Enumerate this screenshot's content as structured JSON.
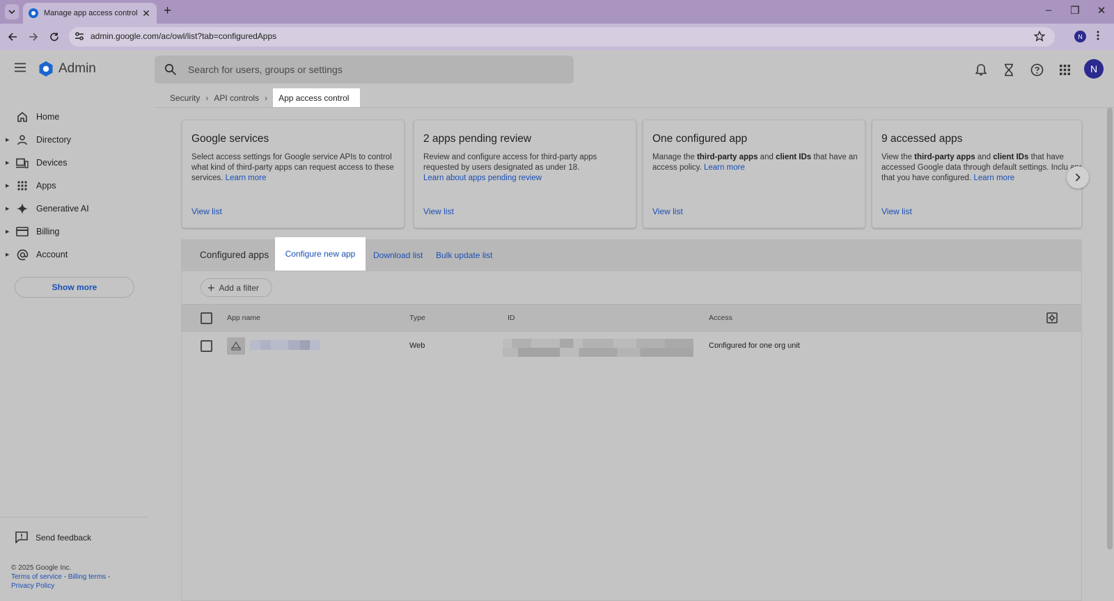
{
  "browser": {
    "tab_title": "Manage app access control – A",
    "url": "admin.google.com/ac/owl/list?tab=configuredApps",
    "profile_initial": "N"
  },
  "header": {
    "app_name": "Admin",
    "search_placeholder": "Search for users, groups or settings",
    "user_initial": "N"
  },
  "breadcrumb": {
    "items": [
      "Security",
      "API controls"
    ],
    "current": "App access control"
  },
  "sidebar": {
    "items": [
      {
        "label": "Home",
        "icon": "home-icon"
      },
      {
        "label": "Directory",
        "icon": "person-icon"
      },
      {
        "label": "Devices",
        "icon": "devices-icon"
      },
      {
        "label": "Apps",
        "icon": "apps-grid-icon"
      },
      {
        "label": "Generative AI",
        "icon": "sparkle-icon"
      },
      {
        "label": "Billing",
        "icon": "credit-card-icon"
      },
      {
        "label": "Account",
        "icon": "at-sign-icon"
      }
    ],
    "show_more": "Show more",
    "send_feedback": "Send feedback",
    "footer": {
      "copyright": "© 2025 Google Inc.",
      "terms": "Terms of service",
      "billing_terms": "Billing terms",
      "privacy": "Privacy Policy"
    }
  },
  "cards": [
    {
      "title": "Google services",
      "desc": "Select access settings for Google service APIs to control what kind of third-party apps can request access to these services.",
      "link": "Learn more",
      "view": "View list"
    },
    {
      "title": "2 apps pending review",
      "desc": "Review and configure access for third-party apps requested by users designated as under 18.",
      "link": "Learn about apps pending review",
      "view": "View list"
    },
    {
      "title": "One configured app",
      "desc_pre": "Manage the ",
      "desc_b1": "third-party apps",
      "desc_mid": " and ",
      "desc_b2": "client IDs",
      "desc_post": " that have an access policy.",
      "link": "Learn more",
      "view": "View list"
    },
    {
      "title": "9 accessed apps",
      "desc_pre": "View the ",
      "desc_b1": "third-party apps",
      "desc_mid": " and ",
      "desc_b2": "client IDs",
      "desc_post": " that have accessed Google data through default settings. Inclu apps that you have configured.",
      "link": "Learn more",
      "view": "View list"
    }
  ],
  "configured_apps": {
    "title": "Configured apps",
    "configure_new": "Configure new app",
    "download": "Download list",
    "bulk_update": "Bulk update list",
    "add_filter": "Add a filter",
    "columns": [
      "App name",
      "Type",
      "ID",
      "Access"
    ],
    "rows": [
      {
        "type": "Web",
        "access": "Configured for one org unit"
      }
    ]
  }
}
